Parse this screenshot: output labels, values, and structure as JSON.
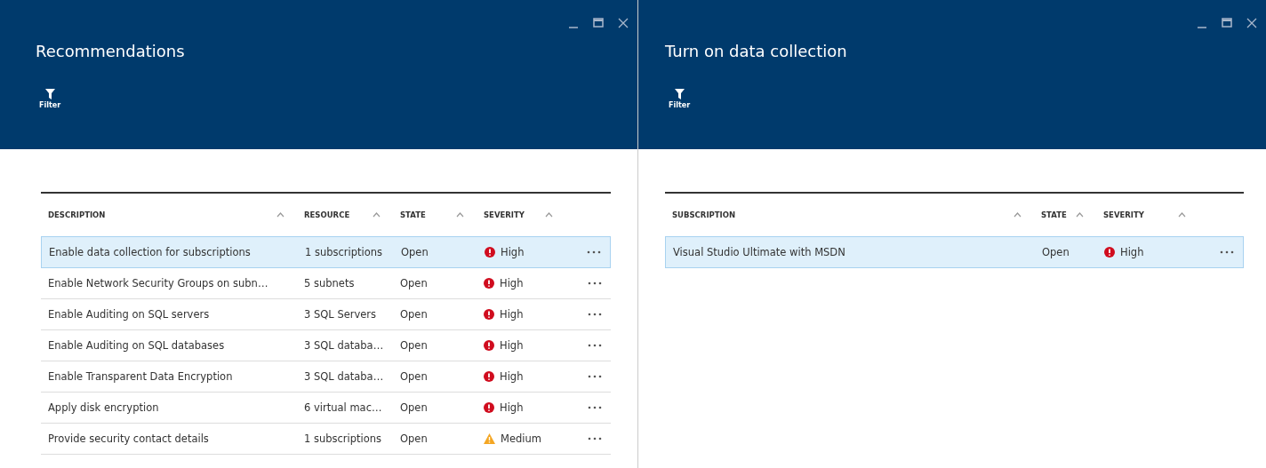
{
  "blades": [
    {
      "title": "Recommendations",
      "toolbar": [
        {
          "label": "Filter"
        }
      ],
      "table": {
        "columns": [
          "DESCRIPTION",
          "RESOURCE",
          "STATE",
          "SEVERITY"
        ],
        "rows": [
          {
            "cells": [
              "Enable data collection for subscriptions",
              "1 subscriptions",
              "Open"
            ],
            "severity": {
              "kind": "high",
              "label": "High"
            },
            "selected": true
          },
          {
            "cells": [
              "Enable Network Security Groups on subn…",
              "5 subnets",
              "Open"
            ],
            "severity": {
              "kind": "high",
              "label": "High"
            },
            "selected": false
          },
          {
            "cells": [
              "Enable Auditing on SQL servers",
              "3 SQL Servers",
              "Open"
            ],
            "severity": {
              "kind": "high",
              "label": "High"
            },
            "selected": false
          },
          {
            "cells": [
              "Enable Auditing on SQL databases",
              "3 SQL databa…",
              "Open"
            ],
            "severity": {
              "kind": "high",
              "label": "High"
            },
            "selected": false
          },
          {
            "cells": [
              "Enable Transparent Data Encryption",
              "3 SQL databa…",
              "Open"
            ],
            "severity": {
              "kind": "high",
              "label": "High"
            },
            "selected": false
          },
          {
            "cells": [
              "Apply disk encryption",
              "6 virtual mac…",
              "Open"
            ],
            "severity": {
              "kind": "high",
              "label": "High"
            },
            "selected": false
          },
          {
            "cells": [
              "Provide security contact details",
              "1 subscriptions",
              "Open"
            ],
            "severity": {
              "kind": "medium",
              "label": "Medium"
            },
            "selected": false
          }
        ]
      }
    },
    {
      "title": "Turn on data collection",
      "toolbar": [
        {
          "label": "Filter"
        }
      ],
      "table": {
        "columns": [
          "SUBSCRIPTION",
          "STATE",
          "SEVERITY"
        ],
        "rows": [
          {
            "cells": [
              "Visual Studio Ultimate with MSDN",
              "Open"
            ],
            "severity": {
              "kind": "high",
              "label": "High"
            },
            "selected": true
          }
        ]
      }
    }
  ]
}
